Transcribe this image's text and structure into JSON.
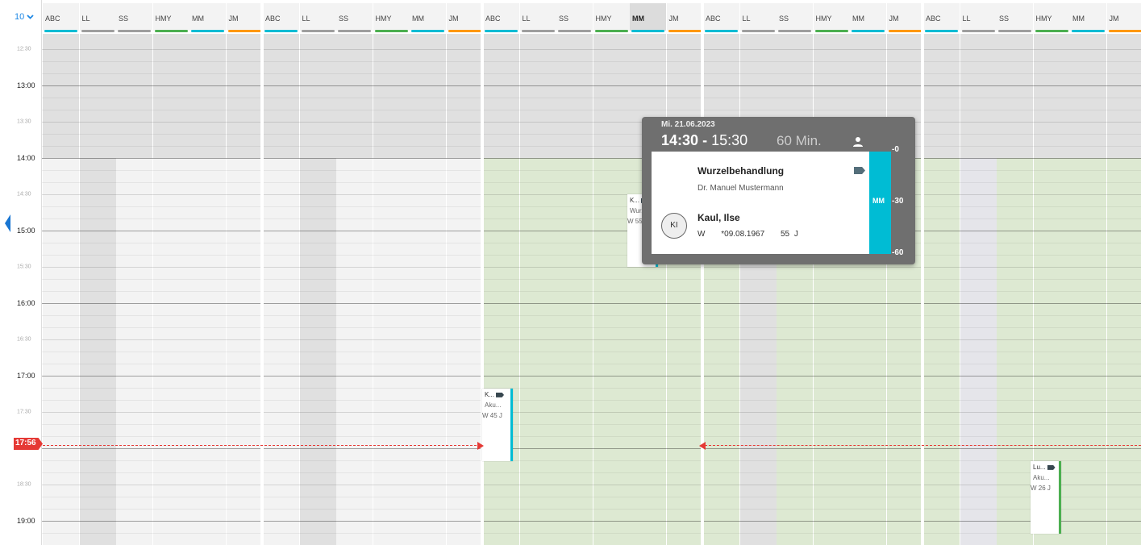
{
  "zoom": {
    "value": "10"
  },
  "time_labels": [
    {
      "label": "12:30",
      "minor": true
    },
    {
      "label": "13:00",
      "minor": false
    },
    {
      "label": "13:30",
      "minor": true
    },
    {
      "label": "14:00",
      "minor": false
    },
    {
      "label": "14:30",
      "minor": true
    },
    {
      "label": "15:00",
      "minor": false
    },
    {
      "label": "15:30",
      "minor": true
    },
    {
      "label": "16:00",
      "minor": false
    },
    {
      "label": "16:30",
      "minor": true
    },
    {
      "label": "17:00",
      "minor": false
    },
    {
      "label": "17:30",
      "minor": true
    },
    {
      "label": "18:30",
      "minor": true
    },
    {
      "label": "19:00",
      "minor": false
    }
  ],
  "resources": [
    {
      "code": "ABC",
      "color": "#00bcd4"
    },
    {
      "code": "LL",
      "color": "#9e9e9e"
    },
    {
      "code": "SS",
      "color": "#9e9e9e"
    },
    {
      "code": "HMY",
      "color": "#4caf50"
    },
    {
      "code": "MM",
      "color": "#00bcd4"
    },
    {
      "code": "JM",
      "color": "#ff9800"
    }
  ],
  "days_count": 5,
  "active_header": {
    "day": 2,
    "resource": 4
  },
  "now": {
    "label": "17:56"
  },
  "appointments": [
    {
      "line1": "K...",
      "line2": "Aku...",
      "line3": "W 45 J",
      "bar_color": "#00bcd4"
    },
    {
      "line1": "K...",
      "line2": "Wur...",
      "line3": "W 55",
      "bar_color": "#00bcd4"
    },
    {
      "line1": "Lu...",
      "line2": "Aku...",
      "line3": "W 26 J",
      "bar_color": "#4caf50"
    }
  ],
  "popup": {
    "date": "Mi. 21.06.2023",
    "start": "14:30",
    "sep": "-",
    "end": "15:30",
    "duration": "60 Min.",
    "treatment": "Wurzelbehandlung",
    "doctor": "Dr. Manuel Mustermann",
    "initials": "KI",
    "patient_name": "Kaul, Ilse",
    "gender": "W",
    "birth": "*09.08.1967",
    "age": "55 J",
    "resource_code": "MM",
    "resource_color": "#00bcd4",
    "scale": [
      "-0",
      "-30",
      "-60"
    ]
  },
  "colors": {
    "open_bg": "#dde9d2",
    "closed_bg": "#f3f3f3",
    "blocked_bg": "#e0e0e0",
    "now_line": "#e53935",
    "accent": "#1e88e5"
  }
}
